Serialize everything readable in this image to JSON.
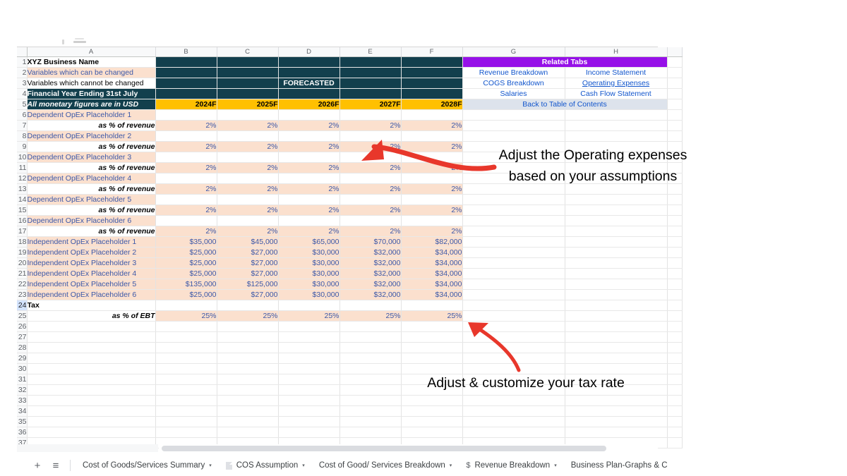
{
  "spreadsheet": {
    "column_headers": [
      "A",
      "B",
      "C",
      "D",
      "E",
      "F",
      "G",
      "H"
    ],
    "row_numbers": [
      "1",
      "2",
      "3",
      "4",
      "5",
      "6",
      "7",
      "8",
      "9",
      "10",
      "11",
      "12",
      "13",
      "14",
      "15",
      "16",
      "17",
      "18",
      "19",
      "20",
      "21",
      "22",
      "23",
      "24",
      "25",
      "26",
      "27",
      "28",
      "29",
      "30",
      "31",
      "32",
      "33",
      "34",
      "35",
      "36",
      "37"
    ],
    "selected_row": "24",
    "titles": {
      "business_name": "XYZ Business Name",
      "legend_changeable": "Variables which can be changed",
      "legend_fixed": "Variables which cannot be changed",
      "financial_year": "Financial Year Ending 31st July",
      "currency_note": "All monetary figures are in USD",
      "forecast_banner": "FORECASTED"
    },
    "year_headers": [
      "2024F",
      "2025F",
      "2026F",
      "2027F",
      "2028F"
    ],
    "related_tabs": {
      "header": "Related Tabs",
      "links": [
        [
          "Revenue Breakdown",
          "Income Statement"
        ],
        [
          "COGS Breakdown",
          "Operating Expenses"
        ],
        [
          "Salaries",
          "Cash Flow Statement"
        ]
      ],
      "active_link": "Operating Expenses",
      "back_link": "Back to Table of Contents"
    },
    "dependent_rows": [
      {
        "label": "Dependent OpEx Placeholder 1",
        "sub": "as % of revenue",
        "values": [
          "2%",
          "2%",
          "2%",
          "2%",
          "2%"
        ]
      },
      {
        "label": "Dependent OpEx Placeholder 2",
        "sub": "as % of revenue",
        "values": [
          "2%",
          "2%",
          "2%",
          "2%",
          "2%"
        ]
      },
      {
        "label": "Dependent OpEx Placeholder 3",
        "sub": "as % of revenue",
        "values": [
          "2%",
          "2%",
          "2%",
          "2%",
          "2%"
        ]
      },
      {
        "label": "Dependent OpEx Placeholder 4",
        "sub": "as % of revenue",
        "values": [
          "2%",
          "2%",
          "2%",
          "2%",
          "2%"
        ]
      },
      {
        "label": "Dependent OpEx Placeholder 5",
        "sub": "as % of revenue",
        "values": [
          "2%",
          "2%",
          "2%",
          "2%",
          "2%"
        ]
      },
      {
        "label": "Dependent OpEx Placeholder 6",
        "sub": "as % of revenue",
        "values": [
          "2%",
          "2%",
          "2%",
          "2%",
          "2%"
        ]
      }
    ],
    "independent_rows": [
      {
        "label": "Independent OpEx Placeholder 1",
        "values": [
          "$35,000",
          "$45,000",
          "$65,000",
          "$70,000",
          "$82,000"
        ]
      },
      {
        "label": "Independent OpEx Placeholder 2",
        "values": [
          "$25,000",
          "$27,000",
          "$30,000",
          "$32,000",
          "$34,000"
        ]
      },
      {
        "label": "Independent OpEx Placeholder 3",
        "values": [
          "$25,000",
          "$27,000",
          "$30,000",
          "$32,000",
          "$34,000"
        ]
      },
      {
        "label": "Independent OpEx Placeholder 4",
        "values": [
          "$25,000",
          "$27,000",
          "$30,000",
          "$32,000",
          "$34,000"
        ]
      },
      {
        "label": "Independent OpEx Placeholder 5",
        "values": [
          "$135,000",
          "$125,000",
          "$30,000",
          "$32,000",
          "$34,000"
        ]
      },
      {
        "label": "Independent OpEx Placeholder 6",
        "values": [
          "$25,000",
          "$27,000",
          "$30,000",
          "$32,000",
          "$34,000"
        ]
      }
    ],
    "tax": {
      "label": "Tax",
      "sub": "as % of EBT",
      "values": [
        "25%",
        "25%",
        "25%",
        "25%",
        "25%"
      ]
    }
  },
  "annotations": {
    "note_opex": "Adjust the Operating expenses based on your assumptions",
    "note_tax": "Adjust & customize your tax rate",
    "arrow_color": "#e8372b"
  },
  "tabbar": {
    "add_label": "+",
    "menu_label": "≡",
    "tabs": [
      {
        "label": "Cost of Goods/Services Summary",
        "icon": "none",
        "caret": "▾"
      },
      {
        "label": "COS Assumption",
        "icon": "doc-icon",
        "caret": "▾"
      },
      {
        "label": "Cost of Good/ Services Breakdown",
        "icon": "none",
        "caret": "▾"
      },
      {
        "label": "Revenue Breakdown",
        "icon": "dollar-icon",
        "caret": "▾"
      },
      {
        "label": "Business Plan-Graphs & C",
        "icon": "none",
        "caret": ""
      }
    ]
  },
  "colors": {
    "teal": "#123f4d",
    "gold": "#ffc000",
    "peach": "#fbe0ce",
    "purple": "#9610e8",
    "link_blue": "#1155cc",
    "value_blue": "#3c58a8",
    "lavender": "#dde3ec"
  }
}
